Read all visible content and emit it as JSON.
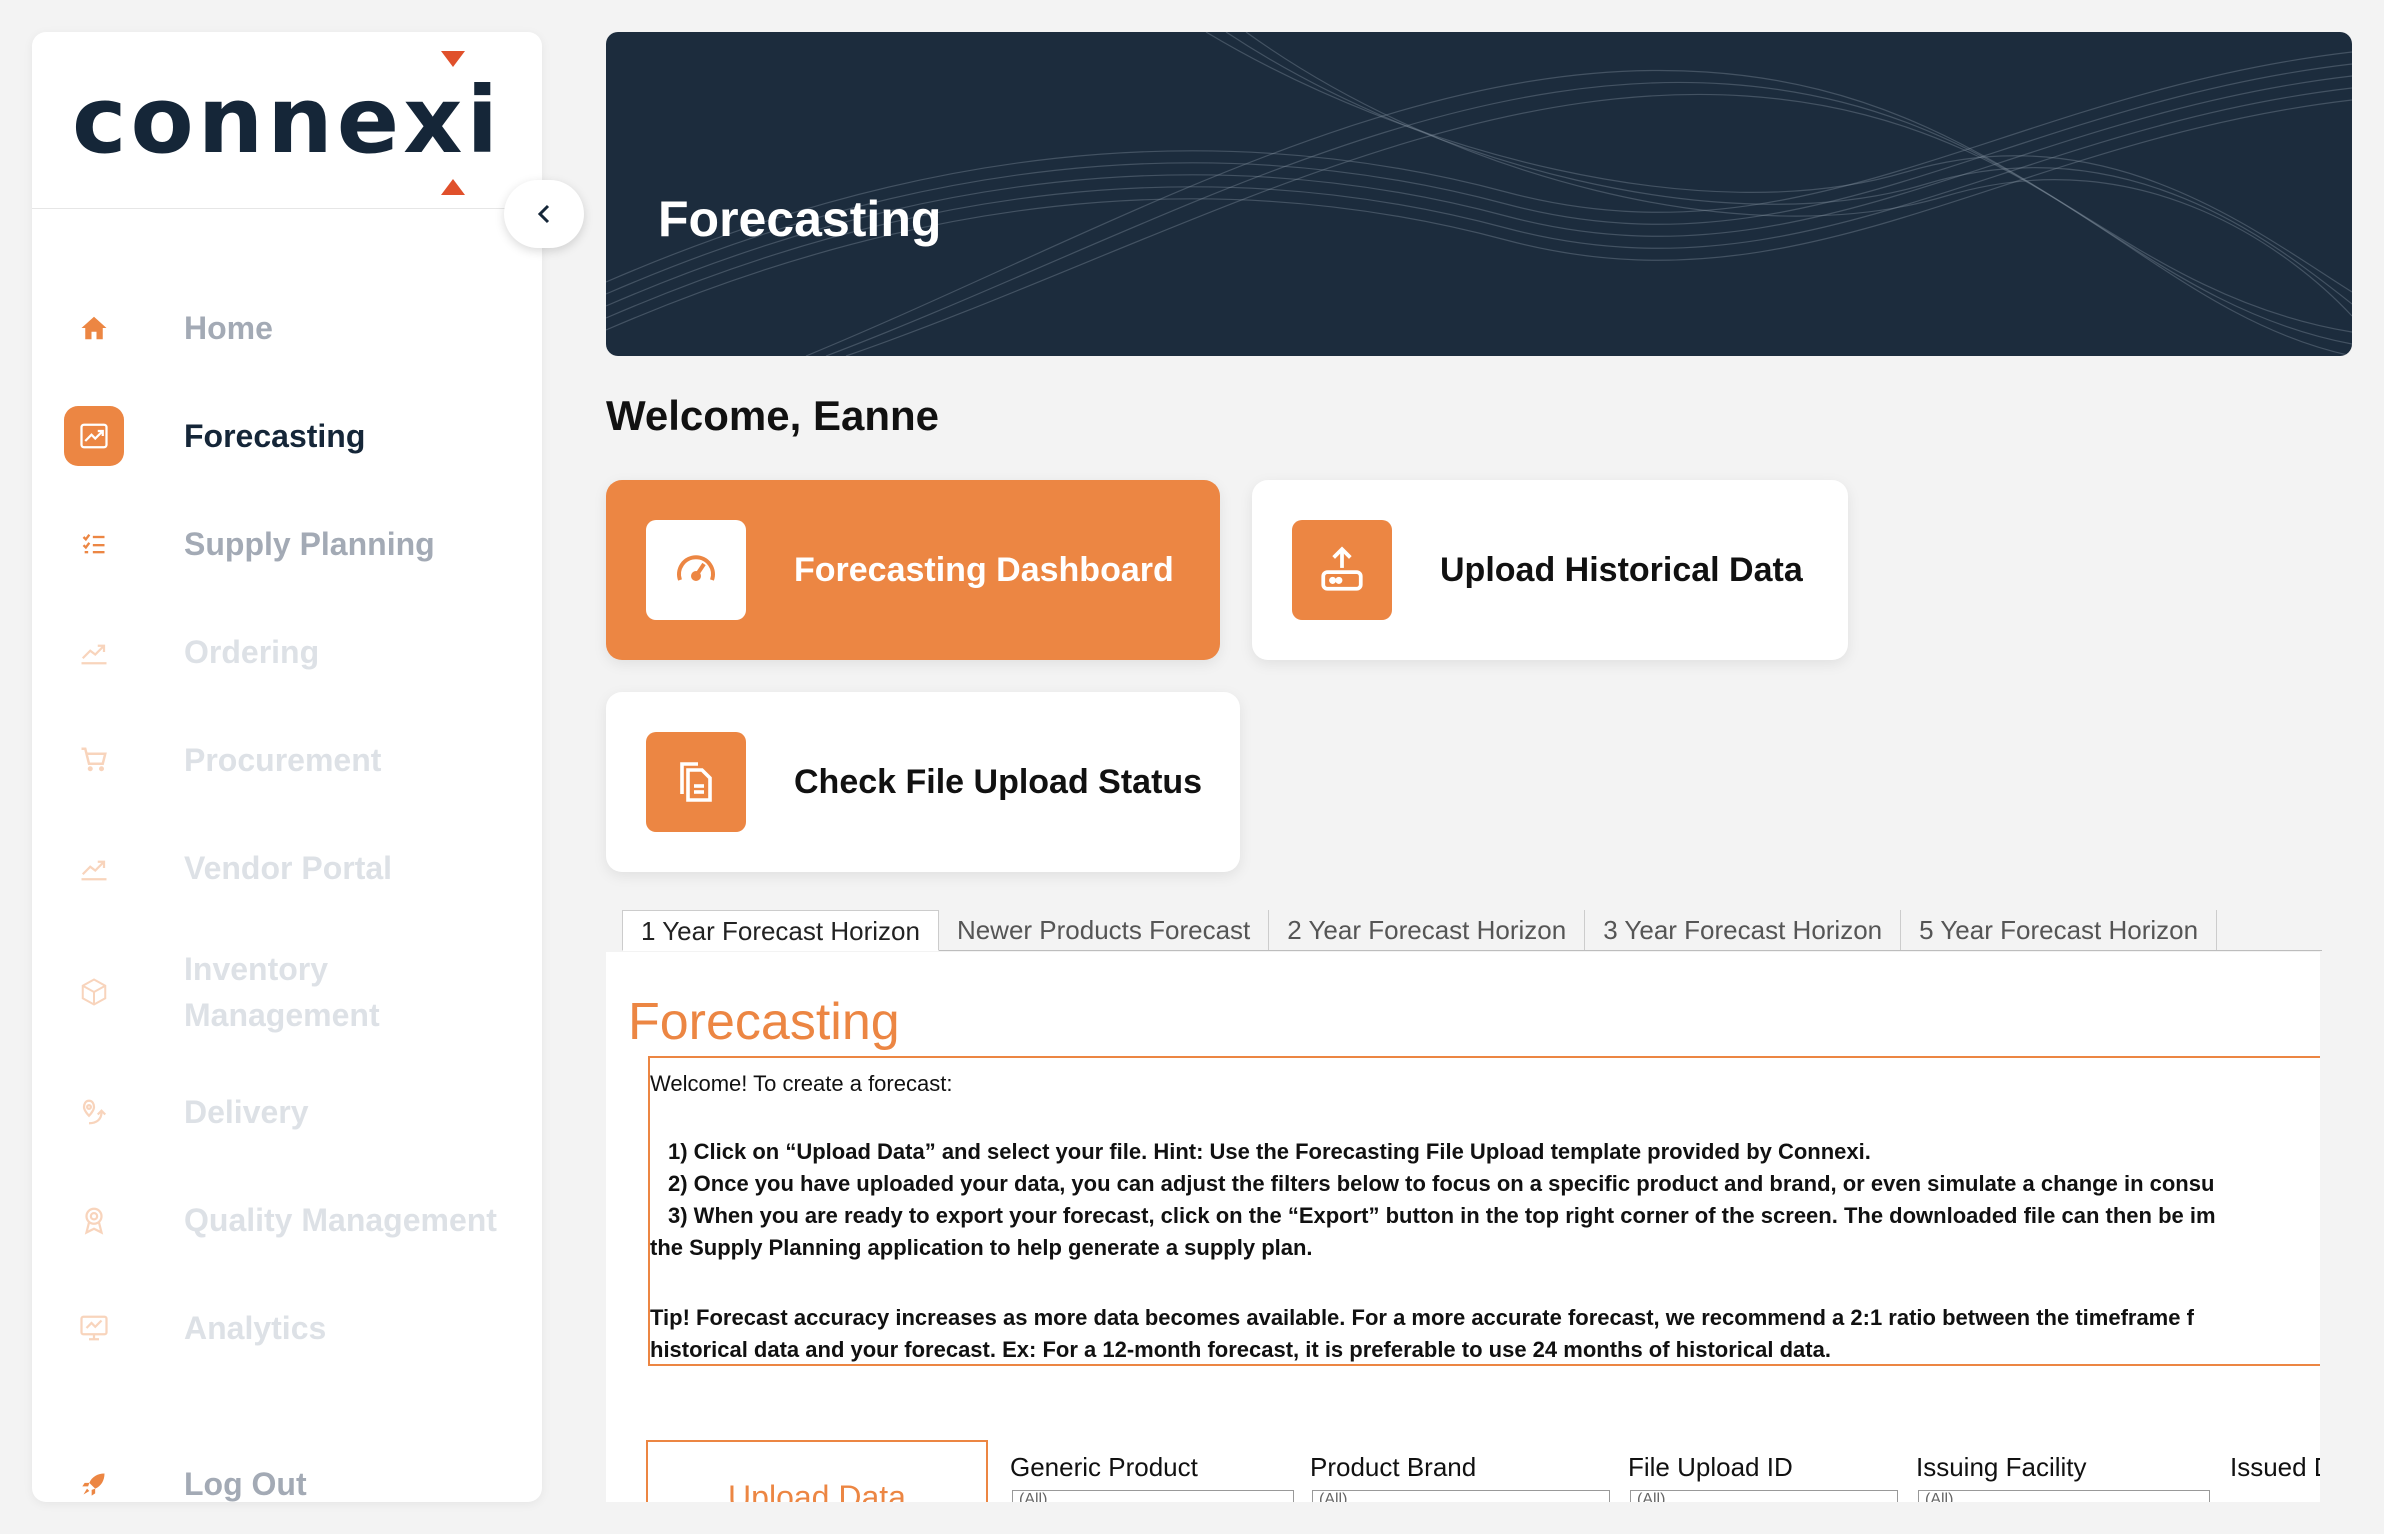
{
  "sidebar": {
    "logo_text": "connexi",
    "items": [
      {
        "label": "Home",
        "icon": "home-icon"
      },
      {
        "label": "Forecasting",
        "icon": "trend-icon"
      },
      {
        "label": "Supply Planning",
        "icon": "checklist-icon"
      },
      {
        "label": "Ordering",
        "icon": "trend-icon"
      },
      {
        "label": "Procurement",
        "icon": "cart-icon"
      },
      {
        "label": "Vendor Portal",
        "icon": "trend-icon"
      },
      {
        "label": "Inventory\nManagement",
        "label_line1": "Inventory",
        "label_line2": "Management",
        "icon": "box-icon"
      },
      {
        "label": "Delivery",
        "icon": "delivery-icon"
      },
      {
        "label": "Quality Management",
        "icon": "award-icon"
      },
      {
        "label": "Analytics",
        "icon": "monitor-icon"
      }
    ],
    "logout_label": "Log Out",
    "active_item": "Forecasting"
  },
  "banner": {
    "title": "Forecasting"
  },
  "welcome": "Welcome, Eanne",
  "cards": [
    {
      "label": "Forecasting Dashboard",
      "icon": "gauge-icon"
    },
    {
      "label": "Upload Historical Data",
      "icon": "upload-icon"
    },
    {
      "label": "Check File Upload Status",
      "icon": "files-icon"
    }
  ],
  "tabs": [
    "1 Year Forecast Horizon",
    "Newer Products Forecast",
    "2 Year Forecast Horizon",
    "3 Year Forecast Horizon",
    "5 Year Forecast Horizon"
  ],
  "content": {
    "title": "Forecasting",
    "intro": "Welcome! To create a forecast:",
    "step1": "1) Click on “Upload Data” and select your file. Hint: Use the Forecasting File Upload template provided by Connexi.",
    "step2": "2) Once you have uploaded your data, you can adjust the filters below to focus on a specific product and brand, or even simulate a change in consu",
    "step3": "3) When you are ready to export your forecast, click on the “Export” button in the top right corner of the screen. The downloaded file can then be im",
    "step3_cont": "the Supply Planning application to help generate a supply plan.",
    "tip1": "Tip! Forecast accuracy increases as more data becomes available. For a more accurate forecast, we recommend a 2:1 ratio between the timeframe f",
    "tip2": "historical data and your forecast. Ex: For a 12-month forecast, it is preferable to use 24 months of historical data.",
    "upload_button": "Upload Data",
    "filters": [
      "Generic Product",
      "Product Brand",
      "File Upload ID",
      "Issuing Facility",
      "Issued D"
    ],
    "filter_value": "(All)"
  },
  "colors": {
    "accent": "#ec8643",
    "navy": "#1c2c3d",
    "muted": "#a3aab5"
  }
}
